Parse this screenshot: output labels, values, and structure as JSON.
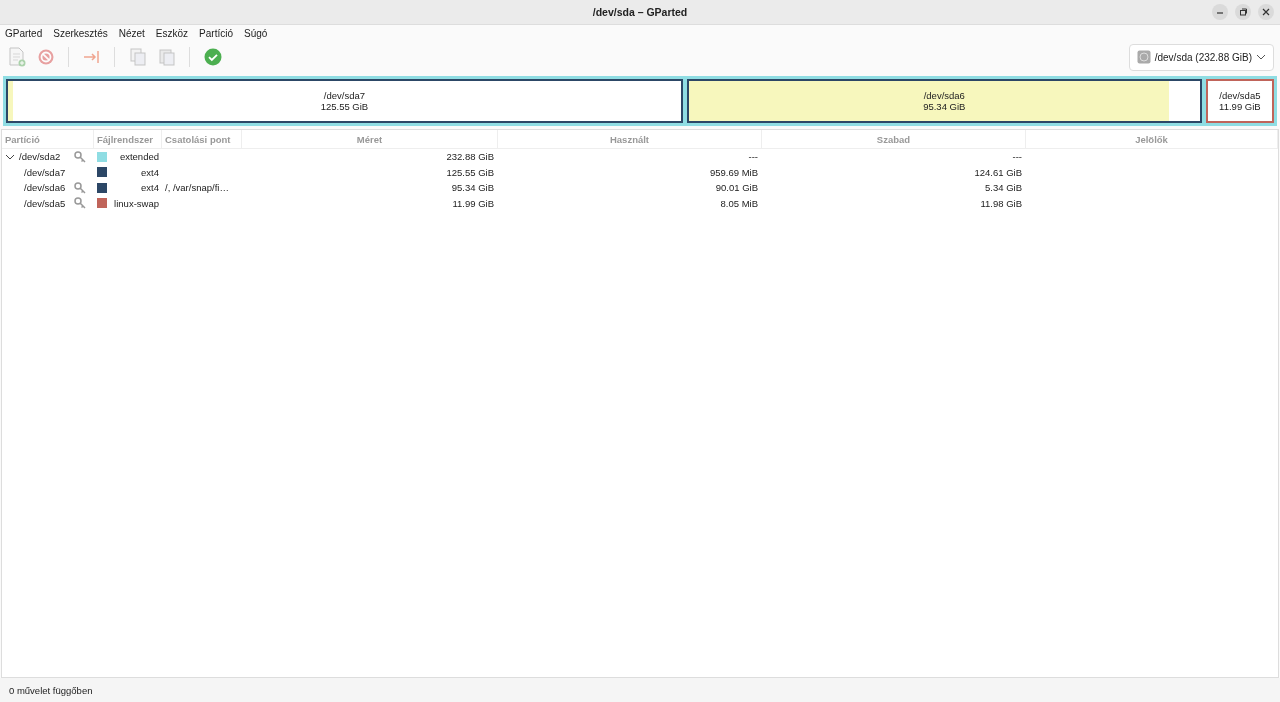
{
  "window": {
    "title": "/dev/sda – GParted"
  },
  "menu": [
    "GParted",
    "Szerkesztés",
    "Nézet",
    "Eszköz",
    "Partíció",
    "Súgó"
  ],
  "toolbar": [
    {
      "kind": "new",
      "disabled": true
    },
    {
      "kind": "delete",
      "disabled": true
    },
    {
      "kind": "sep"
    },
    {
      "kind": "resize",
      "disabled": true
    },
    {
      "kind": "sep"
    },
    {
      "kind": "copy",
      "disabled": true
    },
    {
      "kind": "paste",
      "disabled": true
    },
    {
      "kind": "sep"
    },
    {
      "kind": "apply",
      "disabled": false
    }
  ],
  "device": {
    "label": "/dev/sda (232.88 GiB)"
  },
  "map": [
    {
      "name": "/dev/sda7",
      "size": "125.55 GiB",
      "color": "#2c4766",
      "level": 0.008
    },
    {
      "name": "/dev/sda6",
      "size": "95.34 GiB",
      "color": "#2c4766",
      "level": 0.94
    },
    {
      "name": "/dev/sda5",
      "size": "11.99 GiB",
      "color": "#c0645a",
      "level": 0.0
    }
  ],
  "table": {
    "columns": [
      "Partíció",
      "Fájlrendszer",
      "Csatolási pont",
      "Méret",
      "Használt",
      "Szabad",
      "Jelölők"
    ],
    "rows": [
      {
        "partition": "/dev/sda2",
        "expanded": true,
        "locked": true,
        "color": "#8fdde3",
        "fs": "extended",
        "size": "232.88 GiB",
        "used": "---",
        "free": "---",
        "children": [
          {
            "partition": "/dev/sda7",
            "locked": false,
            "color": "#2c4766",
            "fs": "ext4",
            "size": "125.55 GiB",
            "used": "959.69 MiB",
            "free": "124.61 GiB"
          },
          {
            "partition": "/dev/sda6",
            "locked": true,
            "color": "#2c4766",
            "fs": "ext4",
            "mount": "/, /var/snap/fi…",
            "size": "95.34 GiB",
            "used": "90.01 GiB",
            "free": "5.34 GiB"
          },
          {
            "partition": "/dev/sda5",
            "locked": true,
            "color": "#c0645a",
            "fs": "linux-swap",
            "size": "11.99 GiB",
            "used": "8.05 MiB",
            "free": "11.98 GiB"
          }
        ]
      }
    ]
  },
  "status_bar": "0 művelet függőben"
}
